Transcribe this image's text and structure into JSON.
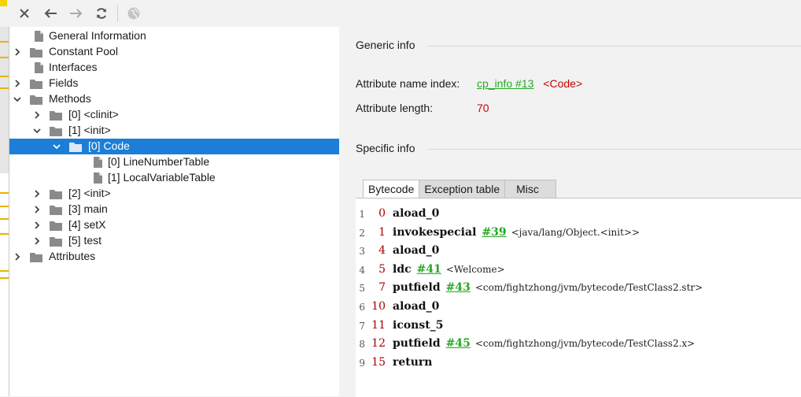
{
  "toolbar": {
    "buttons": [
      {
        "icon": "close-icon"
      },
      {
        "icon": "back-arrow-icon"
      },
      {
        "icon": "forward-arrow-icon",
        "disabled": true
      },
      {
        "icon": "refresh-icon"
      },
      {
        "icon": "globe-icon",
        "disabled": true
      }
    ]
  },
  "tree": {
    "items": [
      {
        "label": "General Information",
        "type": "file",
        "expander": "none"
      },
      {
        "label": "Constant Pool",
        "type": "folder",
        "expander": "collapsed"
      },
      {
        "label": "Interfaces",
        "type": "file",
        "expander": "none"
      },
      {
        "label": "Fields",
        "type": "folder",
        "expander": "collapsed"
      },
      {
        "label": "Methods",
        "type": "folder",
        "expander": "expanded"
      },
      {
        "label": "[0] <clinit>",
        "type": "folder",
        "expander": "collapsed"
      },
      {
        "label": "[1] <init>",
        "type": "folder",
        "expander": "expanded"
      },
      {
        "label": "[0] Code",
        "type": "folder",
        "expander": "expanded",
        "selected": true
      },
      {
        "label": "[0] LineNumberTable",
        "type": "file",
        "expander": "none"
      },
      {
        "label": "[1] LocalVariableTable",
        "type": "file",
        "expander": "none"
      },
      {
        "label": "[2] <init>",
        "type": "folder",
        "expander": "collapsed"
      },
      {
        "label": "[3] main",
        "type": "folder",
        "expander": "collapsed"
      },
      {
        "label": "[4] setX",
        "type": "folder",
        "expander": "collapsed"
      },
      {
        "label": "[5] test",
        "type": "folder",
        "expander": "collapsed"
      },
      {
        "label": "Attributes",
        "type": "folder",
        "expander": "collapsed"
      }
    ]
  },
  "generic": {
    "title": "Generic info",
    "name_index_label": "Attribute name index:",
    "name_index_link": "cp_info #13",
    "name_index_value": "<Code>",
    "length_label": "Attribute length:",
    "length_value": "70"
  },
  "specific": {
    "title": "Specific info",
    "tabs": [
      "Bytecode",
      "Exception table",
      "Misc"
    ],
    "active_tab": "Bytecode"
  },
  "bytecode": [
    {
      "line": "1",
      "offset": "0",
      "op": "aload_0",
      "ref": "",
      "comment": ""
    },
    {
      "line": "2",
      "offset": "1",
      "op": "invokespecial",
      "ref": "#39",
      "comment": "<java/lang/Object.<init>>"
    },
    {
      "line": "3",
      "offset": "4",
      "op": "aload_0",
      "ref": "",
      "comment": ""
    },
    {
      "line": "4",
      "offset": "5",
      "op": "ldc",
      "ref": "#41",
      "comment": "<Welcome>"
    },
    {
      "line": "5",
      "offset": "7",
      "op": "putfield",
      "ref": "#43",
      "comment": "<com/fightzhong/jvm/bytecode/TestClass2.str>"
    },
    {
      "line": "6",
      "offset": "10",
      "op": "aload_0",
      "ref": "",
      "comment": ""
    },
    {
      "line": "7",
      "offset": "11",
      "op": "iconst_5",
      "ref": "",
      "comment": ""
    },
    {
      "line": "8",
      "offset": "12",
      "op": "putfield",
      "ref": "#45",
      "comment": "<com/fightzhong/jvm/bytecode/TestClass2.x>"
    },
    {
      "line": "9",
      "offset": "15",
      "op": "return",
      "ref": "",
      "comment": ""
    }
  ],
  "colors": {
    "selection": "#1c7ed6",
    "link": "#22aa22",
    "value_red": "#cc0000",
    "offset_red": "#aa0000"
  }
}
